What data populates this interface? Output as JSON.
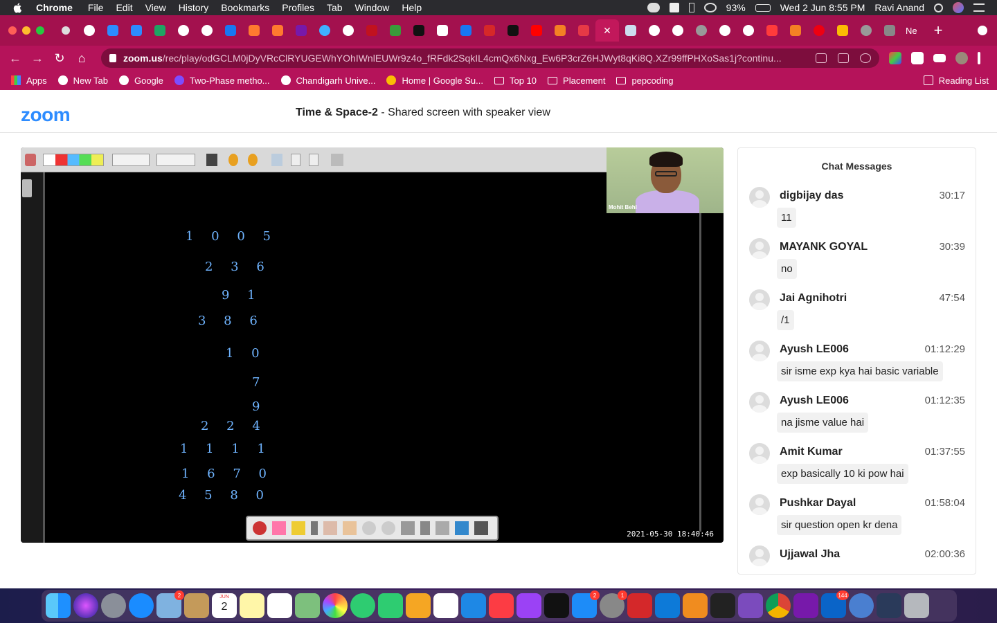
{
  "menubar": {
    "app": "Chrome",
    "items": [
      "File",
      "Edit",
      "View",
      "History",
      "Bookmarks",
      "Profiles",
      "Tab",
      "Window",
      "Help"
    ],
    "battery": "93%",
    "datetime": "Wed 2 Jun  8:55 PM",
    "user": "Ravi Anand"
  },
  "tabs": {
    "active_close": "✕",
    "last_label": "Ne",
    "new_tab": "+"
  },
  "address": {
    "domain": "zoom.us",
    "path": "/rec/play/odGCLM0jDyVRcClRYUGEWhYOhIWnlEUWr9z4o_fRFdk2SqkIL4cmQx6Nxg_Ew6P3crZ6HJWyt8qKi8Q.XZr99ffPHXoSas1j?continu..."
  },
  "bookmarks": {
    "items": [
      "Apps",
      "New Tab",
      "Google",
      "Two-Phase metho...",
      "Chandigarh Unive...",
      "Home | Google Su...",
      "Top 10",
      "Placement",
      "pepcoding"
    ],
    "reading_list": "Reading List"
  },
  "zoom": {
    "logo": "zoom",
    "title_main": "Time & Space-2",
    "title_sub": " - Shared screen with speaker view"
  },
  "video": {
    "speaker_name": "Mohit Behl",
    "timestamp": "2021-05-30  18:40:46",
    "handwriting": [
      "1 0 0 5",
      "2 3 6",
      "9 1",
      "3 8 6",
      "1 0",
      "7",
      "9",
      "2 2 4",
      "1 1 1 1",
      "1 6 7 0",
      "4 5 8 0"
    ]
  },
  "chat": {
    "title": "Chat Messages",
    "messages": [
      {
        "sender": "digbijay das",
        "time": "30:17",
        "text": "11"
      },
      {
        "sender": "MAYANK GOYAL",
        "time": "30:39",
        "text": "no"
      },
      {
        "sender": "Jai Agnihotri",
        "time": "47:54",
        "text": "/1"
      },
      {
        "sender": "Ayush LE006",
        "time": "01:12:29",
        "text": "sir isme exp kya hai basic variable"
      },
      {
        "sender": "Ayush LE006",
        "time": "01:12:35",
        "text": "na jisme value hai"
      },
      {
        "sender": "Amit Kumar",
        "time": "01:37:55",
        "text": "exp basically 10 ki pow hai"
      },
      {
        "sender": "Pushkar Dayal",
        "time": "01:58:04",
        "text": "sir question open kr dena"
      },
      {
        "sender": "Ujjawal Jha",
        "time": "02:00:36",
        "text": ""
      }
    ]
  },
  "dock": {
    "badges": {
      "mail": "2",
      "calendar_date": "2",
      "appstore": "2",
      "prefs": "1",
      "outlook": "144"
    },
    "calendar_month": "JUN"
  }
}
